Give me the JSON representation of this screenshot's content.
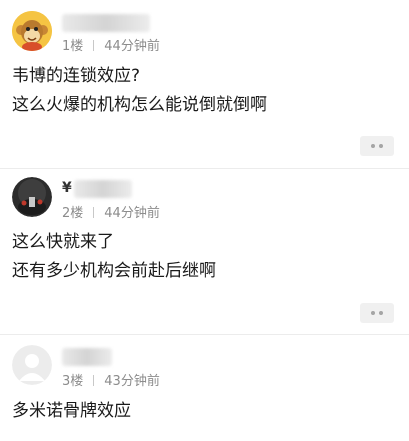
{
  "comments": [
    {
      "name_prefix": "",
      "floor": "1楼",
      "time": "44分钟前",
      "lines": [
        "韦博的连锁效应?",
        "这么火爆的机构怎么能说倒就倒啊"
      ],
      "avatar_icon": "monkey-avatar-icon"
    },
    {
      "name_prefix": "¥",
      "floor": "2楼",
      "time": "44分钟前",
      "lines": [
        "这么快就来了",
        "还有多少机构会前赴后继啊"
      ],
      "avatar_icon": "night-photo-avatar-icon"
    },
    {
      "name_prefix": "",
      "floor": "3楼",
      "time": "43分钟前",
      "lines": [
        "多米诺骨牌效应"
      ],
      "avatar_icon": "default-user-avatar-icon"
    }
  ],
  "more_icon": "more-dots-icon",
  "colors": {
    "meta": "#8c8c8c",
    "button_bg": "#f0f0f0",
    "divider": "#ececec"
  }
}
